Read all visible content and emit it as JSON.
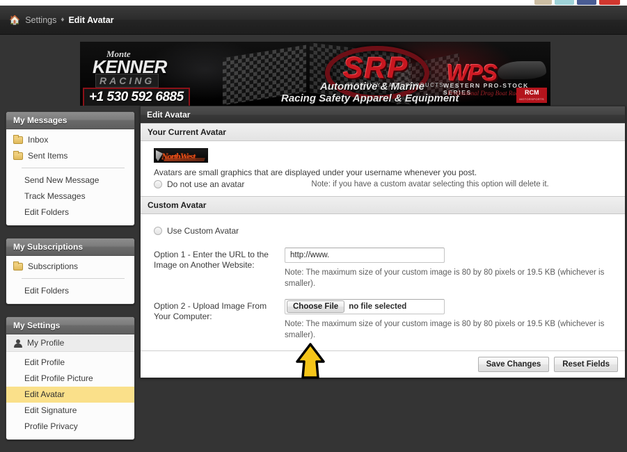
{
  "browser": {
    "tabs": [
      {
        "name": "tab-sliver-1",
        "color": "#cdbfa4"
      },
      {
        "name": "tab-sliver-2",
        "color": "#9fd3d8"
      },
      {
        "name": "tab-sliver-3",
        "color": "#4a5d94"
      },
      {
        "name": "tab-sliver-4",
        "color": "#d2372f"
      }
    ]
  },
  "breadcrumb": {
    "home_icon": "home-icon",
    "settings_label": "Settings",
    "separator": "♦",
    "current_label": "Edit Avatar"
  },
  "banner": {
    "kenner_script": "Monte",
    "kenner_main": "KENNER",
    "kenner_sub": "RACING",
    "kenner_phone": "+1 530 592 6885",
    "srp_big": "SRP",
    "srp_small": "SECURITY RACE PRODUCTS",
    "srp_line1": "Automotive & Marine",
    "srp_line2": "Racing Safety Apparel & Equipment",
    "wps_main": "WPS",
    "wps_sub": "WESTERN PRO-STOCK SERIES",
    "wps_sub2": "Professional Drag Boat Racing",
    "rcm_badge": "RCM",
    "rcm_badge_sub": "MOTORSPORTS"
  },
  "sidebar": {
    "panels": [
      {
        "title": "My Messages",
        "items": [
          {
            "label": "Inbox",
            "icon": "folder-icon",
            "type": "folder"
          },
          {
            "label": "Sent Items",
            "icon": "folder-icon",
            "type": "folder"
          },
          {
            "type": "separator"
          },
          {
            "label": "Send New Message",
            "type": "link"
          },
          {
            "label": "Track Messages",
            "type": "link"
          },
          {
            "label": "Edit Folders",
            "type": "link"
          }
        ]
      },
      {
        "title": "My Subscriptions",
        "items": [
          {
            "label": "Subscriptions",
            "icon": "folder-icon",
            "type": "folder"
          },
          {
            "type": "separator"
          },
          {
            "label": "Edit Folders",
            "type": "link"
          }
        ]
      },
      {
        "title": "My Settings",
        "items": [
          {
            "label": "My Profile",
            "icon": "user-icon",
            "type": "profile"
          },
          {
            "label": "Edit Profile",
            "type": "link"
          },
          {
            "label": "Edit Profile Picture",
            "type": "link"
          },
          {
            "label": "Edit Avatar",
            "type": "link",
            "active": true
          },
          {
            "label": "Edit Signature",
            "type": "link"
          },
          {
            "label": "Profile Privacy",
            "type": "link"
          }
        ]
      }
    ],
    "active_item_color": "#fae08a"
  },
  "main": {
    "header": "Edit Avatar",
    "current_avatar": {
      "section_title": "Your Current Avatar",
      "avatar_alt": "current-avatar-thumbnail",
      "description": "Avatars are small graphics that are displayed under your username whenever you post.",
      "radio_label": "Do not use an avatar",
      "radio_selected": false,
      "radio_note": "Note: if you have a custom avatar selecting this option will delete it."
    },
    "custom_avatar": {
      "section_title": "Custom Avatar",
      "use_custom_label": "Use Custom Avatar",
      "use_custom_selected": false,
      "option1": {
        "label": "Option 1 - Enter the URL to the Image on Another Website:",
        "value": "http://www.",
        "placeholder": "http://www.",
        "note": "Note: The maximum size of your custom image is 80 by 80 pixels or 19.5 KB (whichever is smaller)."
      },
      "option2": {
        "label": "Option 2 - Upload Image From Your Computer:",
        "choose_button": "Choose File",
        "file_status": "no file selected",
        "note": "Note: The maximum size of your custom image is 80 by 80 pixels or 19.5 KB (whichever is smaller)."
      }
    },
    "footer": {
      "save_label": "Save Changes",
      "reset_label": "Reset Fields"
    }
  },
  "annotation": {
    "cursor": "up-arrow-pointer",
    "color": "#f5c518"
  }
}
